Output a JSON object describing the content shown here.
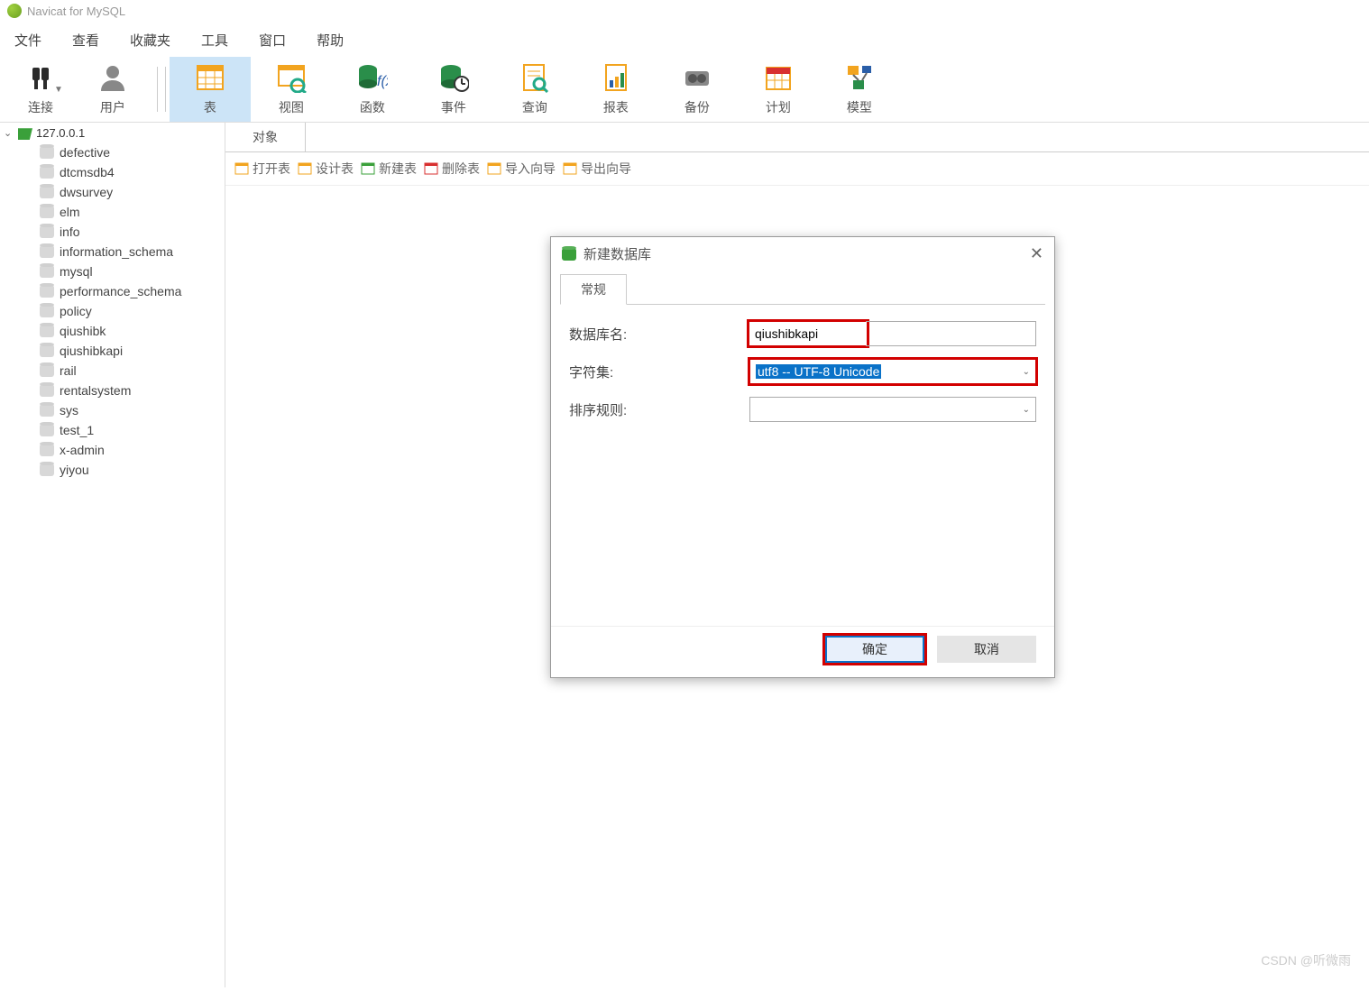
{
  "app_title": "Navicat for MySQL",
  "menus": [
    "文件",
    "查看",
    "收藏夹",
    "工具",
    "窗口",
    "帮助"
  ],
  "toolbar": [
    {
      "label": "连接",
      "icon": "plug"
    },
    {
      "label": "用户",
      "icon": "user"
    },
    {
      "label": "表",
      "icon": "table",
      "active": true
    },
    {
      "label": "视图",
      "icon": "view"
    },
    {
      "label": "函数",
      "icon": "function"
    },
    {
      "label": "事件",
      "icon": "event"
    },
    {
      "label": "查询",
      "icon": "query"
    },
    {
      "label": "报表",
      "icon": "report"
    },
    {
      "label": "备份",
      "icon": "backup"
    },
    {
      "label": "计划",
      "icon": "schedule"
    },
    {
      "label": "模型",
      "icon": "model"
    }
  ],
  "server_node": "127.0.0.1",
  "databases": [
    "defective",
    "dtcmsdb4",
    "dwsurvey",
    "elm",
    "info",
    "information_schema",
    "mysql",
    "performance_schema",
    "policy",
    "qiushibk",
    "qiushibkapi",
    "rail",
    "rentalsystem",
    "sys",
    "test_1",
    "x-admin",
    "yiyou"
  ],
  "main_tab": "对象",
  "subbar": [
    "打开表",
    "设计表",
    "新建表",
    "删除表",
    "导入向导",
    "导出向导"
  ],
  "dialog": {
    "title": "新建数据库",
    "tab": "常规",
    "db_name_label": "数据库名:",
    "db_name_value": "qiushibkapi",
    "charset_label": "字符集:",
    "charset_value": "utf8 -- UTF-8 Unicode",
    "collation_label": "排序规则:",
    "collation_value": "",
    "ok": "确定",
    "cancel": "取消"
  },
  "watermark": "CSDN @听微雨"
}
